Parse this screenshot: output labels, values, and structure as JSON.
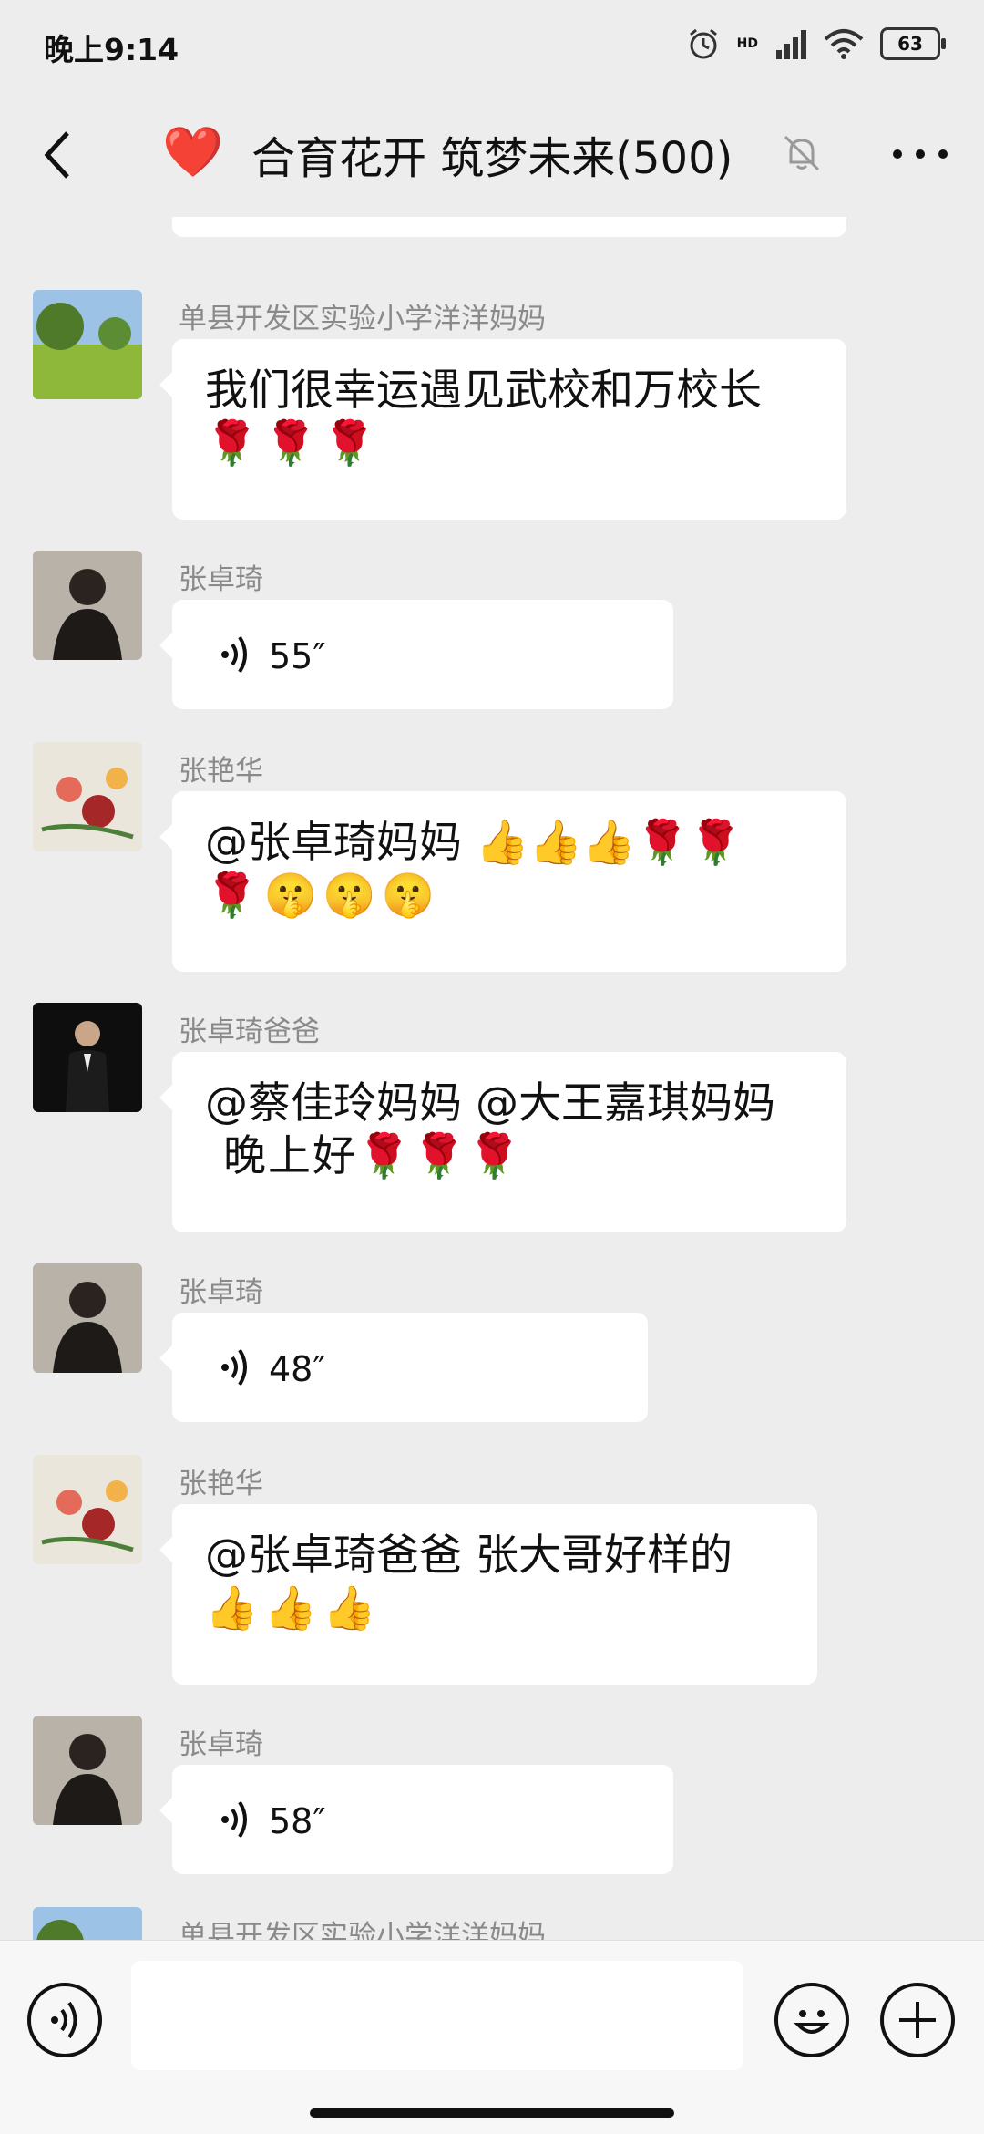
{
  "status_bar": {
    "time": "晚上9:14",
    "battery": "63",
    "network": "HD"
  },
  "nav": {
    "heart": "❤️",
    "title": "合育花开 筑梦未来(500)"
  },
  "messages": [
    {
      "sender": "单县开发区实验小学洋洋妈妈",
      "text": "我们很幸运遇见武校和万校长",
      "emoji": "🌹🌹🌹"
    },
    {
      "sender": "张卓琦",
      "voice": "55″"
    },
    {
      "sender": "张艳华",
      "text": "@张卓琦妈妈 👍👍👍🌹🌹",
      "emoji": "🌹🤫🤫🤫"
    },
    {
      "sender": "张卓琦爸爸",
      "text": "@蔡佳玲妈妈 @大王嘉琪妈妈",
      "text2": "晚上好🌹🌹🌹"
    },
    {
      "sender": "张卓琦",
      "voice": "48″"
    },
    {
      "sender": "张艳华",
      "text": "@张卓琦爸爸 张大哥好样的",
      "emoji": "👍👍👍"
    },
    {
      "sender": "张卓琦",
      "voice": "58″"
    },
    {
      "sender": "单县开发区实验小学洋洋妈妈"
    }
  ]
}
